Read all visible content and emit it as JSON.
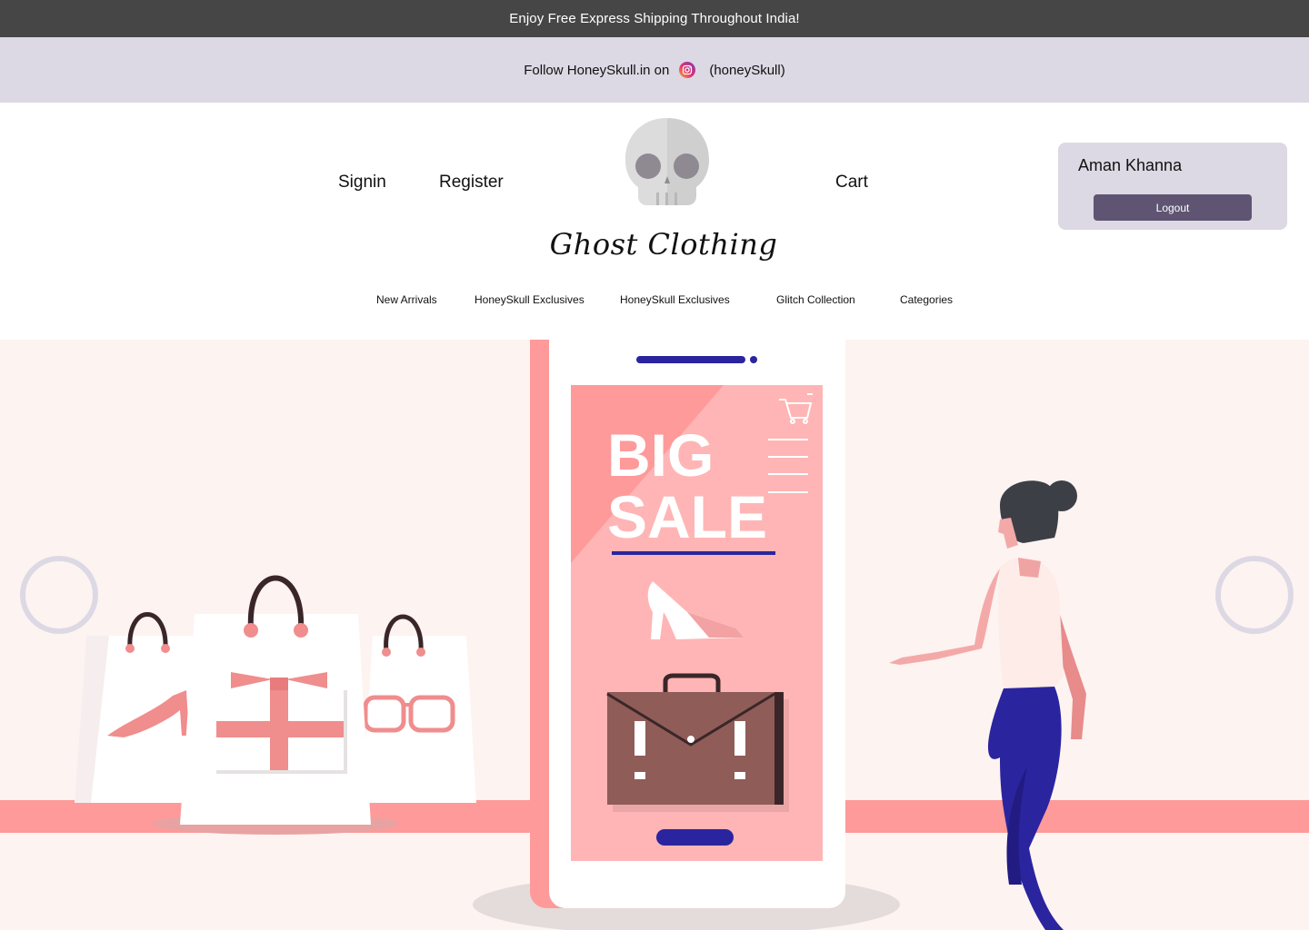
{
  "banner": {
    "text": "Enjoy Free Express Shipping Throughout India!"
  },
  "social": {
    "prefix": "Follow HoneySkull.in on",
    "icon": "instagram-icon",
    "handle": "(honeySkull)"
  },
  "header": {
    "signin": "Signin",
    "register": "Register",
    "cart": "Cart",
    "brand": "Ghost Clothing",
    "logo_icon": "skull-icon"
  },
  "user": {
    "name": "Aman Khanna",
    "logout": "Logout"
  },
  "categories": [
    "New Arrivals",
    "HoneySkull Exclusives",
    "HoneySkull Exclusives",
    "Glitch Collection",
    "Categories"
  ],
  "hero": {
    "headline_line1": "BIG",
    "headline_line2": "SALE"
  },
  "colors": {
    "topbar": "#464646",
    "followbar": "#dcd9e4",
    "button": "#5f5572",
    "hero_bg": "#fdf3f1",
    "accent_pink": "#fe9a9a",
    "accent_blue": "#2b249f"
  }
}
